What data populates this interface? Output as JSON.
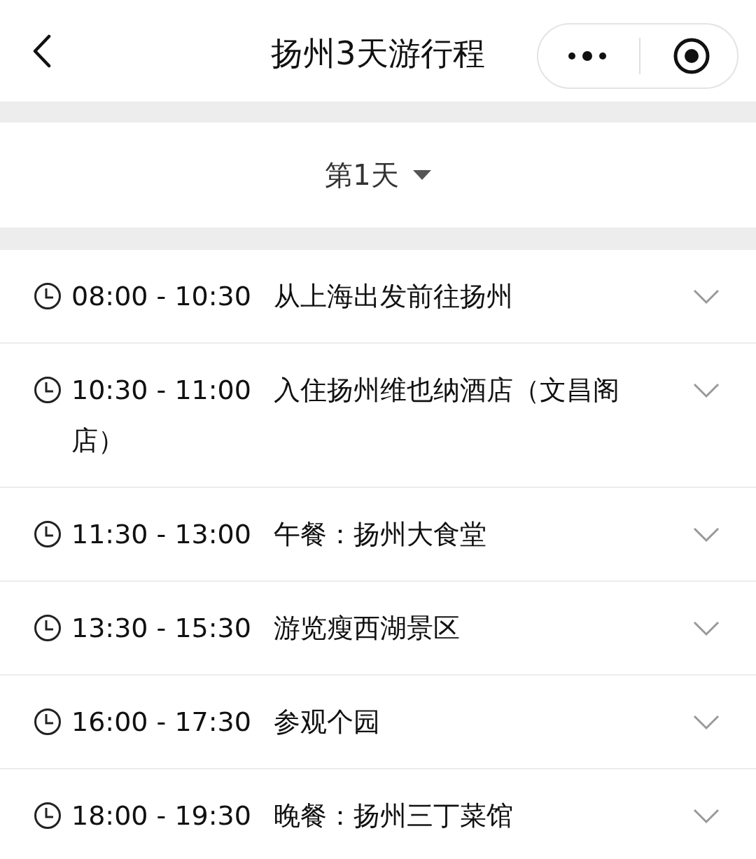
{
  "header": {
    "title": "扬州3天游行程"
  },
  "day_selector": {
    "label": "第1天",
    "expanded": false
  },
  "schedule": [
    {
      "time": "08:00 - 10:30",
      "title": "从上海出发前往扬州",
      "expanded": false
    },
    {
      "time": "10:30 - 11:00",
      "title": "入住扬州维也纳酒店（文昌阁店）",
      "expanded": false
    },
    {
      "time": "11:30 - 13:00",
      "title": "午餐：扬州大食堂",
      "expanded": false
    },
    {
      "time": "13:30 - 15:30",
      "title": "游览瘦西湖景区",
      "expanded": false
    },
    {
      "time": "16:00 - 17:30",
      "title": "参观个园",
      "expanded": false
    },
    {
      "time": "18:00 - 19:30",
      "title": "晚餐：扬州三丁菜馆",
      "expanded": false
    }
  ]
}
